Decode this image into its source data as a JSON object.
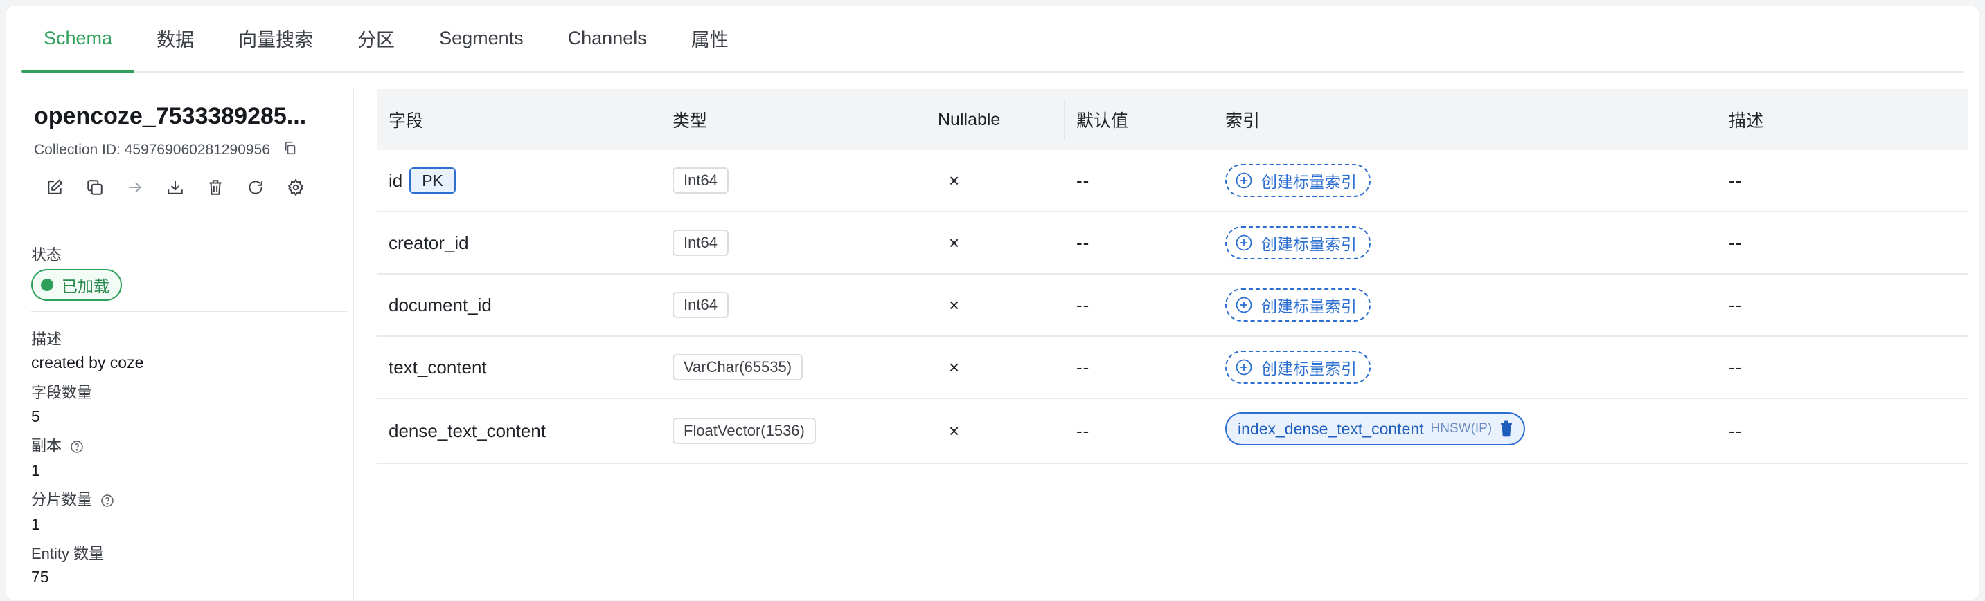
{
  "tabs": [
    {
      "label": "Schema",
      "active": true
    },
    {
      "label": "数据"
    },
    {
      "label": "向量搜索"
    },
    {
      "label": "分区"
    },
    {
      "label": "Segments"
    },
    {
      "label": "Channels"
    },
    {
      "label": "属性"
    }
  ],
  "collection": {
    "name": "opencoze_7533389285...",
    "id_text": "Collection ID: 459769060281290956"
  },
  "icons": [
    "edit-icon",
    "duplicate-icon",
    "arrow-right-icon",
    "download-icon",
    "delete-icon",
    "refresh-icon",
    "settings-icon"
  ],
  "info": {
    "status_label": "状态",
    "status_value": "已加载",
    "description_label": "描述",
    "description_value": "created by coze",
    "field_count_label": "字段数量",
    "field_count_value": "5",
    "replica_label": "副本",
    "replica_value": "1",
    "shard_label": "分片数量",
    "shard_value": "1",
    "entity_label": "Entity 数量",
    "entity_value": "75"
  },
  "table": {
    "headers": {
      "field": "字段",
      "type": "类型",
      "nullable": "Nullable",
      "default": "默认值",
      "index": "索引",
      "description": "描述"
    },
    "pk_label": "PK",
    "create_index_label": "创建标量索引",
    "rows": [
      {
        "field": "id",
        "type": "Int64",
        "nullable": "×",
        "default": "--",
        "description": "--"
      },
      {
        "field": "creator_id",
        "type": "Int64",
        "nullable": "×",
        "default": "--",
        "description": "--"
      },
      {
        "field": "document_id",
        "type": "Int64",
        "nullable": "×",
        "default": "--",
        "description": "--"
      },
      {
        "field": "text_content",
        "type": "VarChar(65535)",
        "nullable": "×",
        "default": "--",
        "description": "--"
      },
      {
        "field": "dense_text_content",
        "type": "FloatVector(1536)",
        "nullable": "×",
        "default": "--",
        "description": "--",
        "index_name": "index_dense_text_content",
        "index_type": "HNSW(IP)"
      }
    ]
  },
  "colors": {
    "accent_green": "#2fa05a",
    "accent_blue": "#2c6fd1"
  }
}
